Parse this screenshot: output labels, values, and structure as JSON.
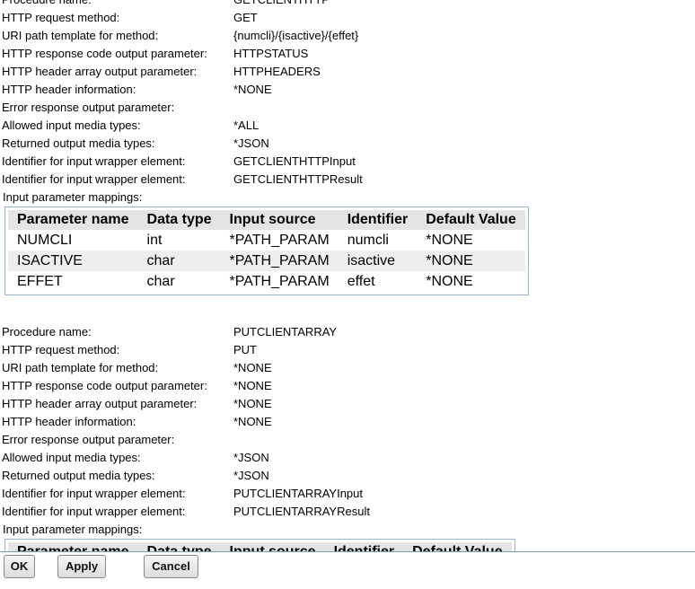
{
  "procedures": [
    {
      "properties": [
        {
          "label": "Procedure name:",
          "value": "GETCLIENTHTTP"
        },
        {
          "label": "HTTP request method:",
          "value": "GET"
        },
        {
          "label": "URI path template for method:",
          "value": "{numcli}/{isactive}/{effet}"
        },
        {
          "label": "HTTP response code output parameter:",
          "value": "HTTPSTATUS"
        },
        {
          "label": "HTTP header array output parameter:",
          "value": "HTTPHEADERS"
        },
        {
          "label": "HTTP header information:",
          "value": "*NONE"
        },
        {
          "label": "Error response output parameter:",
          "value": ""
        },
        {
          "label": "Allowed input media types:",
          "value": "*ALL"
        },
        {
          "label": "Returned output media types:",
          "value": "*JSON"
        },
        {
          "label": "Identifier for input wrapper element:",
          "value": "GETCLIENTHTTPInput"
        },
        {
          "label": "Identifier for input wrapper element:",
          "value": "GETCLIENTHTTPResult"
        }
      ],
      "mappings_label": "Input parameter mappings:",
      "columns": [
        "Parameter name",
        "Data type",
        "Input source",
        "Identifier",
        "Default Value"
      ],
      "rows": [
        [
          "NUMCLI",
          "int",
          "*PATH_PARAM",
          "numcli",
          "*NONE"
        ],
        [
          "ISACTIVE",
          "char",
          "*PATH_PARAM",
          "isactive",
          "*NONE"
        ],
        [
          "EFFET",
          "char",
          "*PATH_PARAM",
          "effet",
          "*NONE"
        ]
      ]
    },
    {
      "properties": [
        {
          "label": "Procedure name:",
          "value": "PUTCLIENTARRAY"
        },
        {
          "label": "HTTP request method:",
          "value": "PUT"
        },
        {
          "label": "URI path template for method:",
          "value": "*NONE"
        },
        {
          "label": "HTTP response code output parameter:",
          "value": "*NONE"
        },
        {
          "label": "HTTP header array output parameter:",
          "value": "*NONE"
        },
        {
          "label": "HTTP header information:",
          "value": "*NONE"
        },
        {
          "label": "Error response output parameter:",
          "value": ""
        },
        {
          "label": "Allowed input media types:",
          "value": "*JSON"
        },
        {
          "label": "Returned output media types:",
          "value": "*JSON"
        },
        {
          "label": "Identifier for input wrapper element:",
          "value": "PUTCLIENTARRAYInput"
        },
        {
          "label": "Identifier for input wrapper element:",
          "value": "PUTCLIENTARRAYResult"
        }
      ],
      "mappings_label": "Input parameter mappings:",
      "columns": [
        "Parameter name",
        "Data type",
        "Input source",
        "Identifier",
        "Default Value"
      ],
      "rows": []
    }
  ],
  "buttons": {
    "ok": "OK",
    "apply": "Apply",
    "cancel": "Cancel"
  }
}
